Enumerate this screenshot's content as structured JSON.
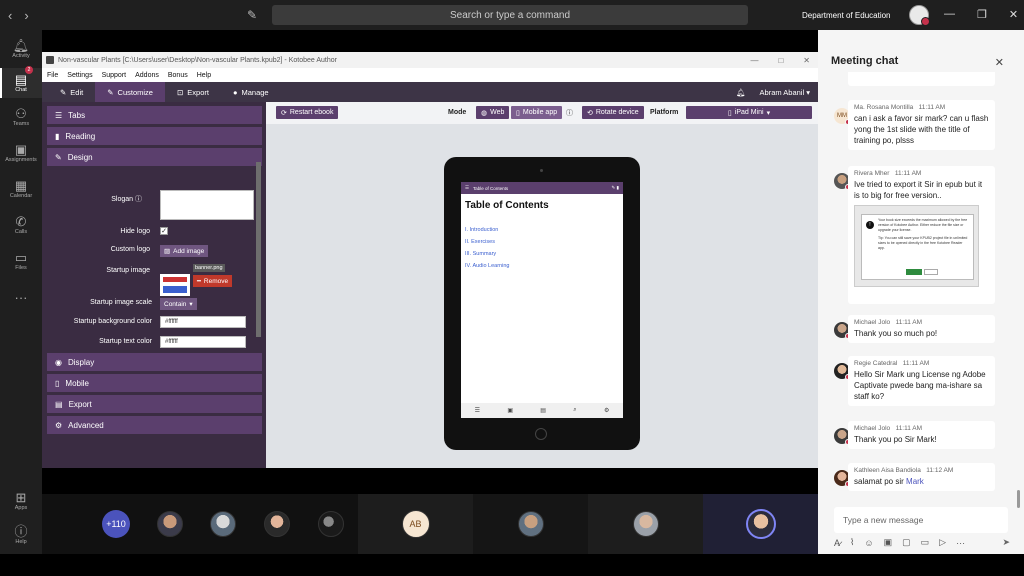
{
  "topbar": {
    "search_placeholder": "Search or type a command",
    "org": "Department of Education"
  },
  "rail": {
    "items": [
      {
        "label": "Activity",
        "icon": "bell-icon"
      },
      {
        "label": "Chat",
        "icon": "chat-icon",
        "badge": "2"
      },
      {
        "label": "Teams",
        "icon": "teams-icon"
      },
      {
        "label": "Assignments",
        "icon": "assignments-icon"
      },
      {
        "label": "Calendar",
        "icon": "calendar-icon"
      },
      {
        "label": "Calls",
        "icon": "phone-icon"
      },
      {
        "label": "Files",
        "icon": "files-icon"
      },
      {
        "label": "",
        "icon": "more-icon"
      },
      {
        "label": "Apps",
        "icon": "apps-icon"
      },
      {
        "label": "Help",
        "icon": "help-icon"
      }
    ]
  },
  "app": {
    "title": "Non-vascular Plants [C:\\Users\\user\\Desktop\\Non-vascular Plants.kpub2] - Kotobee Author",
    "menu": [
      "File",
      "Settings",
      "Support",
      "Addons",
      "Bonus",
      "Help"
    ],
    "tabs": [
      "Edit",
      "Customize",
      "Export",
      "Manage"
    ],
    "user": "Abram Abanil",
    "sections": {
      "tabs": "Tabs",
      "reading": "Reading",
      "design": "Design",
      "display": "Display",
      "mobile": "Mobile",
      "export": "Export",
      "advanced": "Advanced"
    },
    "design": {
      "slogan_label": "Slogan",
      "hide_logo_label": "Hide logo",
      "custom_logo_label": "Custom logo",
      "add_image": "Add image",
      "startup_image_label": "Startup image",
      "image_file": "banner.png",
      "remove": "Remove",
      "scale_label": "Startup image scale",
      "scale_value": "Contain",
      "bg_label": "Startup background color",
      "bg_value": "#ffffff",
      "text_label": "Startup text color",
      "text_value": "#ffffff"
    },
    "preview": {
      "restart": "Restart ebook",
      "mode_label": "Mode",
      "web": "Web",
      "mobile_app": "Mobile app",
      "rotate": "Rotate device",
      "platform_label": "Platform",
      "platform_value": "iPad Mini"
    },
    "tablet": {
      "header": "Table of Contents",
      "title": "Table of Contents",
      "items": [
        "I. Introduction",
        "II. Exercises",
        "III. Summary",
        "IV. Audio Learning"
      ],
      "footer": [
        "Chapters",
        "Media",
        "Notebook",
        "Search",
        "Settings"
      ]
    }
  },
  "participants": {
    "overflow_count": "+110",
    "initials_tile": "AB"
  },
  "chat": {
    "title": "Meeting chat",
    "messages": [
      {
        "author": "Ma. Rosana Montilla",
        "time": "11:11 AM",
        "initials": "MM",
        "text": "can i ask a favor sir mark? can u flash yong the 1st slide with the title of training po, plsss"
      },
      {
        "author": "Rivera Mher",
        "time": "11:11 AM",
        "text": "Ive tried to export it Sir in epub but it is to big for free version.."
      },
      {
        "author": "Michael Jolo",
        "time": "11:11 AM",
        "text": "Thank you so much po!"
      },
      {
        "author": "Regie Catedral",
        "time": "11:11 AM",
        "text": "Hello Sir Mark ung License ng Adobe Captivate pwede bang ma-ishare sa staff ko?"
      },
      {
        "author": "Michael Jolo",
        "time": "11:11 AM",
        "text": "Thank you po Sir Mark!"
      },
      {
        "author": "Kathleen Aisa Bandiola",
        "time": "11:12 AM",
        "text": "salamat po sir",
        "mention": "Mark"
      }
    ],
    "attachment_text": "Your book size exceeds the maximum allowed by the free version of Kotobee Author. Either reduce the file size or upgrade your license.",
    "attachment_tip": "Tip: You can still save your KPUB2 project file in unlimited sizes to be opened directly in the free Kotobee Reader app.",
    "compose_placeholder": "Type a new message"
  },
  "colors": {
    "purple_panel": "#5b3f6d",
    "teams_accent": "#4b53bc",
    "presence_red": "#c4314b"
  }
}
